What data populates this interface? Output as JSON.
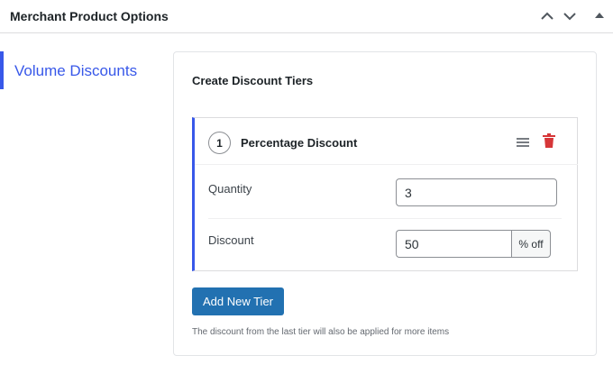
{
  "header": {
    "title": "Merchant Product Options",
    "icons": [
      "chevron-up-icon",
      "chevron-down-icon",
      "triangle-up-icon"
    ]
  },
  "sidebar": {
    "tabs": [
      {
        "label": "Volume Discounts",
        "active": true
      }
    ]
  },
  "panel": {
    "title": "Create Discount Tiers",
    "tiers": [
      {
        "number": "1",
        "title": "Percentage Discount",
        "quantity_label": "Quantity",
        "quantity_value": "3",
        "discount_label": "Discount",
        "discount_value": "50",
        "discount_suffix": "% off",
        "icons": [
          "drag-handle-icon",
          "trash-icon"
        ]
      }
    ],
    "add_button_label": "Add New Tier",
    "help_text": "The discount from the last tier will also be applied for more items"
  },
  "colors": {
    "accent": "#3858e9",
    "button": "#2271b1",
    "trash": "#d63638"
  }
}
